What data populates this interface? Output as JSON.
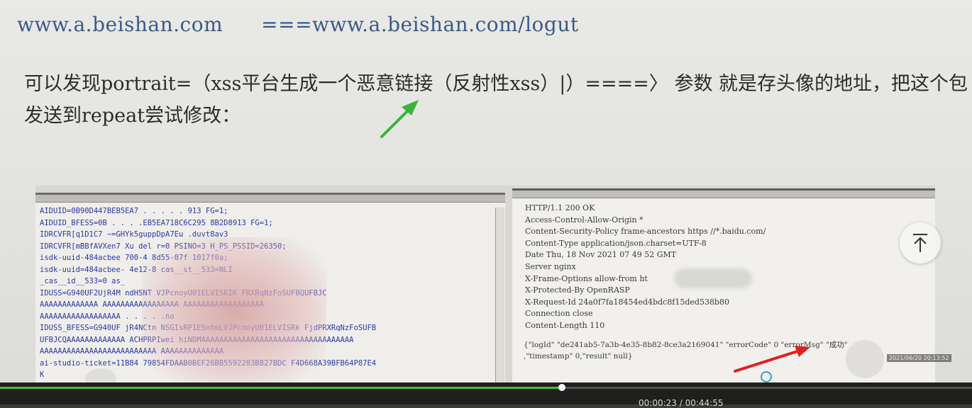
{
  "doc": {
    "url_main": "www.a.beishan.com",
    "url_logout": "===www.a.beishan.com/logut",
    "para_line1": "可以发现portrait=（xss平台生成一个恶意链接（反射性xss）|）====〉 参数 就是存头像的地址，把这个包",
    "para_line2": "发送到repeat尝试修改："
  },
  "request_panel": {
    "lines": [
      "AIDUID=0B90D447BEB5EA7   . . . . . 913 FG=1;",
      "AIDUID_BFESS=0B       . . . .EB5EA718C6C295 8B2D8913 FG=1;",
      "IDRCVFR[q1D1C7         ~=GHYk5guppDpA7Eu  .duvt8av3",
      "IDRCVFR[mBBfAVXen7      Xu  del   r=0  PSINO=3  H_PS_PSSID=26350;",
      "isdk-uuid-484acbee  700-4     8d55-07f  1017f0a;",
      "isdk-uuid=484acbee-     4e12-8                       cas__st__533=NLI",
      "_cas__id__533=0     as_",
      "IDUSS=G940UF2UjR4M   ndHSNT                 VJPcnoyU01ELVISRIK    FRXRqNzFoSUFBQUFBJC",
      "AAAAAAAAAAAAA                                     AAAAAAAAAAAAAAAAA  AAAAAAAAAAAAAAAAAA",
      "AAAAAAAAAAAAAAAAAA           . . . . .no",
      "IDUSS_BFESS=G940UF    jR4NCtn   NSGIsRP1ESnhmLVJPcnoyU01ELVISRk  FjdPRXRqNzFoSUFB",
      "UFBJCQAAAAAAAAAAAAA  ACHPRPIwei     hiNDMAAAAAAAAAAAAAAAAAAAAAAAAAAAAAAAAAA",
      "AAAAAAAAAAAAAAAAAAAAAAAAAA   AAAAAAAAAAAAAA",
      "ai-studio-ticket=11B84    79854FDAAB0BEF26BB5592283B827BDC   F4D668A39BFB64P87E4",
      "K"
    ]
  },
  "response_panel": {
    "lines": [
      "HTTP/1.1 200 OK",
      "Access-Control-Allow-Origin  *",
      "Content-Security-Policy  frame-ancestors https //*.baidu.com/",
      "Content-Type  application/json.charset=UTF-8",
      "Date  Thu, 18 Nov 2021 07 49 52 GMT",
      "Server  nginx",
      "X-Frame-Options  allow-from ht",
      "X-Protected-By  OpenRASP",
      "X-Request-Id  24a0f7fa18454ed4bdc8f15ded538b80",
      "Connection  close",
      "Content-Length  110"
    ],
    "json_line1": "{\"logId\" \"de241ab5-7a3b-4e35-8b82-8ce3a2169041\" \"errorCode\" 0 \"errorMsg\" \"成功\"",
    "json_line2": ",\"timestamp\" 0,\"result\" null}"
  },
  "overlay": {
    "screenshot_timestamp": "2021/06/20 20:13:52",
    "play_time": "00:00:23 / 00:44:55",
    "progress_fraction": 0.578
  },
  "colors": {
    "url_blue": "#3c5a86",
    "request_text": "#2b3aa5",
    "green_arrow": "#36b53b",
    "red_arrow": "#e02020",
    "progress_green": "#3fc23b"
  },
  "icons": [
    "arrow-up-to-top-icon",
    "green-annotation-arrow-icon",
    "red-annotation-arrow-icon"
  ]
}
